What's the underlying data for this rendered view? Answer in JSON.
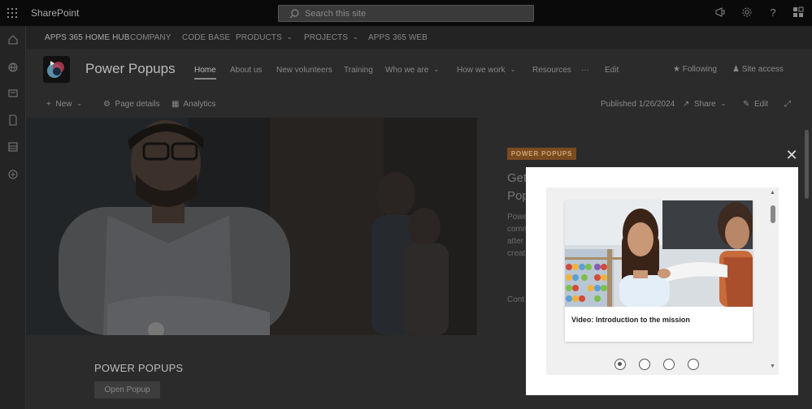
{
  "suite": {
    "brand": "SharePoint",
    "search_placeholder": "Search this site"
  },
  "hub_nav": {
    "items": [
      {
        "label": "APPS 365 HOME HUB"
      },
      {
        "label": "COMPANY"
      },
      {
        "label": "CODE BASE"
      },
      {
        "label": "PRODUCTS"
      },
      {
        "label": "PROJECTS"
      },
      {
        "label": "APPS 365 WEB"
      }
    ]
  },
  "site": {
    "title": "Power Popups",
    "nav": [
      {
        "label": "Home"
      },
      {
        "label": "About us"
      },
      {
        "label": "New volunteers"
      },
      {
        "label": "Training"
      },
      {
        "label": "Who we are"
      },
      {
        "label": "How we work"
      },
      {
        "label": "Resources"
      },
      {
        "label": "···"
      },
      {
        "label": "Edit"
      }
    ],
    "following": "Following",
    "site_access": "Site access"
  },
  "command_bar": {
    "new": "New",
    "page_details": "Page details",
    "analytics": "Analytics",
    "published": "Published 1/26/2024",
    "share": "Share",
    "edit": "Edit"
  },
  "hero_side": {
    "tag": "POWER POPUPS",
    "title_lines": [
      "Get",
      "Pop"
    ],
    "text_lines": [
      "Powe",
      "comm",
      "atter",
      "creat"
    ],
    "cont": "Cont"
  },
  "bottom": {
    "section_title": "POWER POPUPS",
    "open_button": "Open Popup"
  },
  "modal": {
    "card_title": "Video: Introduction to the mission",
    "dots": [
      {
        "active": true
      },
      {
        "active": false
      },
      {
        "active": false
      },
      {
        "active": false
      }
    ]
  }
}
